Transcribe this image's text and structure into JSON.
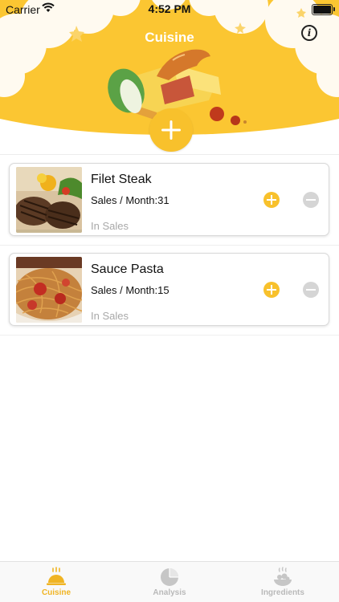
{
  "status_bar": {
    "carrier": "Carrier",
    "time": "4:52 PM"
  },
  "header": {
    "title": "Cuisine",
    "info_icon": "info-circle-icon",
    "add_icon": "plus-icon",
    "accent": "#f8c12c"
  },
  "dishes": [
    {
      "name": "Filet Steak",
      "sales": "Sales / Month:31",
      "status": "In Sales",
      "photo": "filet-steak-photo"
    },
    {
      "name": "Sauce Pasta",
      "sales": "Sales / Month:15",
      "status": "In Sales",
      "photo": "sauce-pasta-photo"
    }
  ],
  "tabs": [
    {
      "label": "Cuisine",
      "icon": "cloche-icon",
      "active": true
    },
    {
      "label": "Analysis",
      "icon": "pie-chart-icon",
      "active": false
    },
    {
      "label": "Ingredients",
      "icon": "ingredients-icon",
      "active": false
    }
  ],
  "colors": {
    "accent": "#f8c12c",
    "inactive": "#b9b9b9",
    "minus": "#d5d5d5"
  }
}
